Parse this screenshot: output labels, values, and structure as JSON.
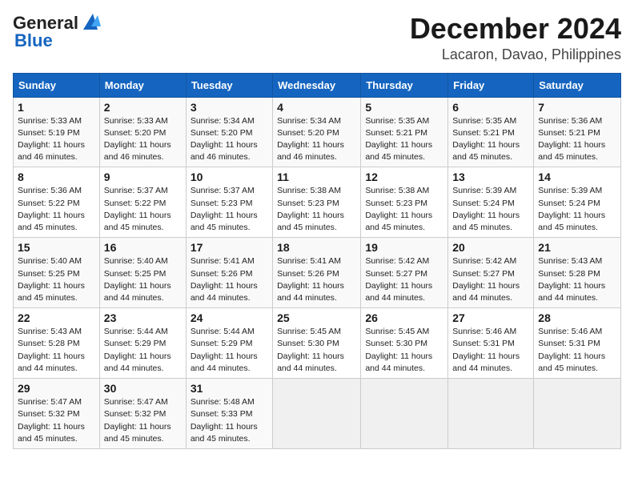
{
  "header": {
    "logo_general": "General",
    "logo_blue": "Blue",
    "month_title": "December 2024",
    "location": "Lacaron, Davao, Philippines"
  },
  "calendar": {
    "days_of_week": [
      "Sunday",
      "Monday",
      "Tuesday",
      "Wednesday",
      "Thursday",
      "Friday",
      "Saturday"
    ],
    "weeks": [
      [
        {
          "day": "",
          "empty": true
        },
        {
          "day": "",
          "empty": true
        },
        {
          "day": "",
          "empty": true
        },
        {
          "day": "",
          "empty": true
        },
        {
          "day": "",
          "empty": true
        },
        {
          "day": "",
          "empty": true
        },
        {
          "day": "",
          "empty": true
        }
      ],
      [
        {
          "day": "1",
          "sunrise": "5:33 AM",
          "sunset": "5:19 PM",
          "daylight": "11 hours and 46 minutes."
        },
        {
          "day": "2",
          "sunrise": "5:33 AM",
          "sunset": "5:20 PM",
          "daylight": "11 hours and 46 minutes."
        },
        {
          "day": "3",
          "sunrise": "5:34 AM",
          "sunset": "5:20 PM",
          "daylight": "11 hours and 46 minutes."
        },
        {
          "day": "4",
          "sunrise": "5:34 AM",
          "sunset": "5:20 PM",
          "daylight": "11 hours and 46 minutes."
        },
        {
          "day": "5",
          "sunrise": "5:35 AM",
          "sunset": "5:21 PM",
          "daylight": "11 hours and 45 minutes."
        },
        {
          "day": "6",
          "sunrise": "5:35 AM",
          "sunset": "5:21 PM",
          "daylight": "11 hours and 45 minutes."
        },
        {
          "day": "7",
          "sunrise": "5:36 AM",
          "sunset": "5:21 PM",
          "daylight": "11 hours and 45 minutes."
        }
      ],
      [
        {
          "day": "8",
          "sunrise": "5:36 AM",
          "sunset": "5:22 PM",
          "daylight": "11 hours and 45 minutes."
        },
        {
          "day": "9",
          "sunrise": "5:37 AM",
          "sunset": "5:22 PM",
          "daylight": "11 hours and 45 minutes."
        },
        {
          "day": "10",
          "sunrise": "5:37 AM",
          "sunset": "5:23 PM",
          "daylight": "11 hours and 45 minutes."
        },
        {
          "day": "11",
          "sunrise": "5:38 AM",
          "sunset": "5:23 PM",
          "daylight": "11 hours and 45 minutes."
        },
        {
          "day": "12",
          "sunrise": "5:38 AM",
          "sunset": "5:23 PM",
          "daylight": "11 hours and 45 minutes."
        },
        {
          "day": "13",
          "sunrise": "5:39 AM",
          "sunset": "5:24 PM",
          "daylight": "11 hours and 45 minutes."
        },
        {
          "day": "14",
          "sunrise": "5:39 AM",
          "sunset": "5:24 PM",
          "daylight": "11 hours and 45 minutes."
        }
      ],
      [
        {
          "day": "15",
          "sunrise": "5:40 AM",
          "sunset": "5:25 PM",
          "daylight": "11 hours and 45 minutes."
        },
        {
          "day": "16",
          "sunrise": "5:40 AM",
          "sunset": "5:25 PM",
          "daylight": "11 hours and 44 minutes."
        },
        {
          "day": "17",
          "sunrise": "5:41 AM",
          "sunset": "5:26 PM",
          "daylight": "11 hours and 44 minutes."
        },
        {
          "day": "18",
          "sunrise": "5:41 AM",
          "sunset": "5:26 PM",
          "daylight": "11 hours and 44 minutes."
        },
        {
          "day": "19",
          "sunrise": "5:42 AM",
          "sunset": "5:27 PM",
          "daylight": "11 hours and 44 minutes."
        },
        {
          "day": "20",
          "sunrise": "5:42 AM",
          "sunset": "5:27 PM",
          "daylight": "11 hours and 44 minutes."
        },
        {
          "day": "21",
          "sunrise": "5:43 AM",
          "sunset": "5:28 PM",
          "daylight": "11 hours and 44 minutes."
        }
      ],
      [
        {
          "day": "22",
          "sunrise": "5:43 AM",
          "sunset": "5:28 PM",
          "daylight": "11 hours and 44 minutes."
        },
        {
          "day": "23",
          "sunrise": "5:44 AM",
          "sunset": "5:29 PM",
          "daylight": "11 hours and 44 minutes."
        },
        {
          "day": "24",
          "sunrise": "5:44 AM",
          "sunset": "5:29 PM",
          "daylight": "11 hours and 44 minutes."
        },
        {
          "day": "25",
          "sunrise": "5:45 AM",
          "sunset": "5:30 PM",
          "daylight": "11 hours and 44 minutes."
        },
        {
          "day": "26",
          "sunrise": "5:45 AM",
          "sunset": "5:30 PM",
          "daylight": "11 hours and 44 minutes."
        },
        {
          "day": "27",
          "sunrise": "5:46 AM",
          "sunset": "5:31 PM",
          "daylight": "11 hours and 44 minutes."
        },
        {
          "day": "28",
          "sunrise": "5:46 AM",
          "sunset": "5:31 PM",
          "daylight": "11 hours and 45 minutes."
        }
      ],
      [
        {
          "day": "29",
          "sunrise": "5:47 AM",
          "sunset": "5:32 PM",
          "daylight": "11 hours and 45 minutes."
        },
        {
          "day": "30",
          "sunrise": "5:47 AM",
          "sunset": "5:32 PM",
          "daylight": "11 hours and 45 minutes."
        },
        {
          "day": "31",
          "sunrise": "5:48 AM",
          "sunset": "5:33 PM",
          "daylight": "11 hours and 45 minutes."
        },
        {
          "day": "",
          "empty": true
        },
        {
          "day": "",
          "empty": true
        },
        {
          "day": "",
          "empty": true
        },
        {
          "day": "",
          "empty": true
        }
      ]
    ]
  }
}
